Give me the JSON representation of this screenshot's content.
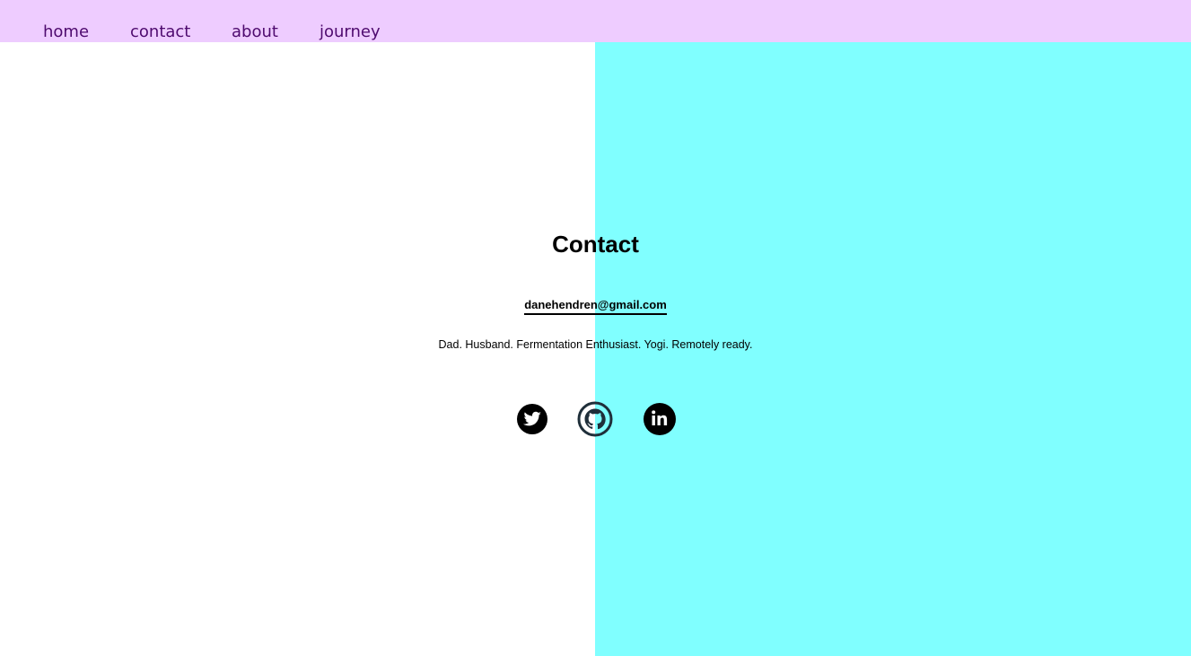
{
  "nav": {
    "items": [
      {
        "label": "home"
      },
      {
        "label": "contact"
      },
      {
        "label": "about"
      },
      {
        "label": "journey"
      }
    ]
  },
  "contact": {
    "title": "Contact",
    "email": "danehendren@gmail.com",
    "tagline": "Dad. Husband. Fermentation Enthusiast. Yogi. Remotely ready."
  },
  "social": [
    {
      "icon": "twitter-icon"
    },
    {
      "icon": "github-icon"
    },
    {
      "icon": "linkedin-icon"
    }
  ],
  "colors": {
    "nav_background": "#eeccff",
    "nav_text": "#4e0a6e",
    "right_panel": "#80ffff",
    "text": "#000000"
  }
}
